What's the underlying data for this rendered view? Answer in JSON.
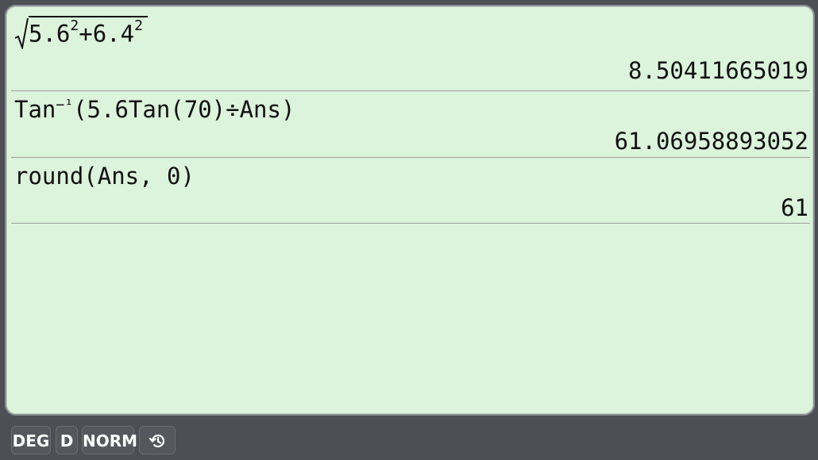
{
  "history": [
    {
      "expression": {
        "radicand_a": "5.6",
        "exp_a": "2",
        "plus": "+",
        "radicand_b": "6.4",
        "exp_b": "2"
      },
      "result": "8.50411665019"
    },
    {
      "expression": {
        "fn": "Tan",
        "inv": "−¹",
        "rest": "(5.6Tan(70)÷Ans)"
      },
      "result": "61.06958893052"
    },
    {
      "expression": {
        "text": "round(Ans, 0)"
      },
      "result": "61"
    }
  ],
  "status": {
    "angle_mode": "DEG",
    "display_mode": "D",
    "number_format": "NORM",
    "history_icon": "history-icon"
  },
  "colors": {
    "screen_bg": "#dcf3dc",
    "bezel": "#4d4f55",
    "text": "#111111",
    "chip_text": "#ffffff"
  }
}
